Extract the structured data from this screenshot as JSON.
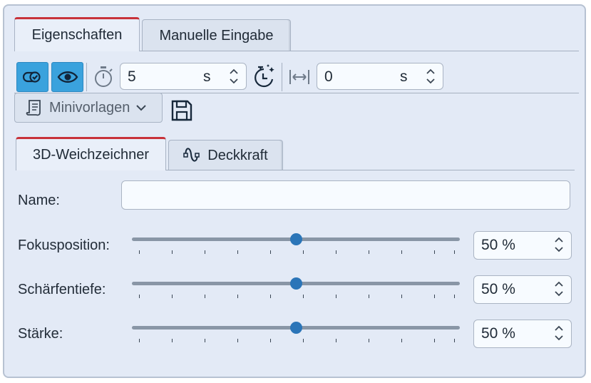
{
  "tabs": [
    {
      "label": "Eigenschaften",
      "active": true
    },
    {
      "label": "Manuelle Eingabe",
      "active": false
    }
  ],
  "toolbar": {
    "duration": {
      "value": "5",
      "unit": "s"
    },
    "offset": {
      "value": "0",
      "unit": "s"
    },
    "accent": "#3aa2dd"
  },
  "presets": {
    "label": "Minivorlagen"
  },
  "subtabs": [
    {
      "label": "3D-Weichzeichner",
      "active": true
    },
    {
      "label": "Deckkraft",
      "active": false
    }
  ],
  "form": {
    "name_label": "Name:",
    "name_value": "",
    "sliders": [
      {
        "label": "Fokusposition:",
        "value": 50,
        "display": "50 %"
      },
      {
        "label": "Schärfentiefe:",
        "value": 50,
        "display": "50 %"
      },
      {
        "label": "Stärke:",
        "value": 50,
        "display": "50 %"
      }
    ]
  }
}
